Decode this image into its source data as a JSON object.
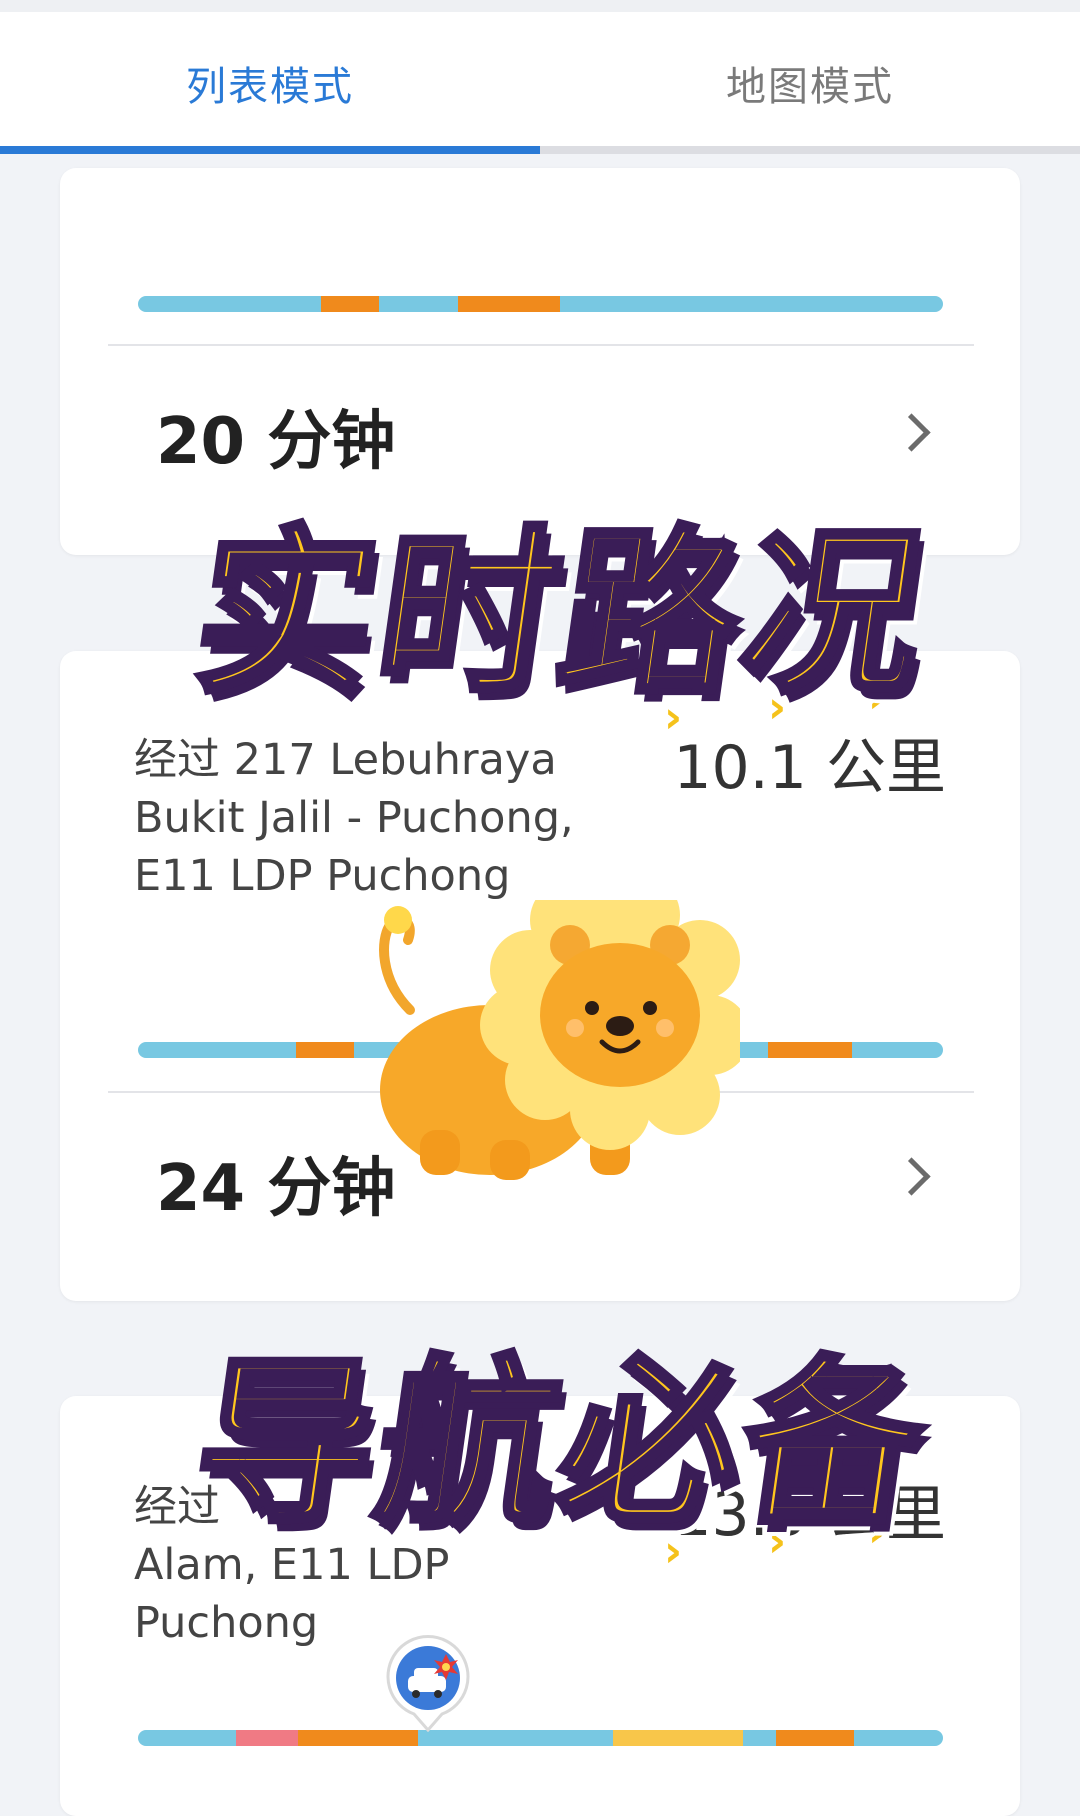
{
  "tabs": {
    "list_label": "列表模式",
    "map_label": "地图模式"
  },
  "routes": [
    {
      "via": "",
      "distance": "",
      "time": "20 分钟"
    },
    {
      "via": "经过 217 Lebuhraya Bukit Jalil - Puchong, E11 LDP Puchong",
      "distance": "10.1 公里",
      "time": "24 分钟"
    },
    {
      "via_line2": "Alam, E11 LDP Puchong",
      "via_prefix": "经过",
      "distance": "13.3 公里"
    }
  ],
  "overlay": {
    "headline_top": "实时路况",
    "headline_bottom": "导航必备"
  },
  "colors": {
    "accent": "#2a7ad6",
    "traffic_free": "#78c8e2",
    "traffic_slow": "#f08a1c",
    "traffic_jam": "#f07a84",
    "traffic_moderate": "#f8c64a"
  },
  "icons": {
    "chevron": "chevron-right-icon",
    "incident": "car-crash-icon",
    "mascot": "lion-mascot"
  }
}
